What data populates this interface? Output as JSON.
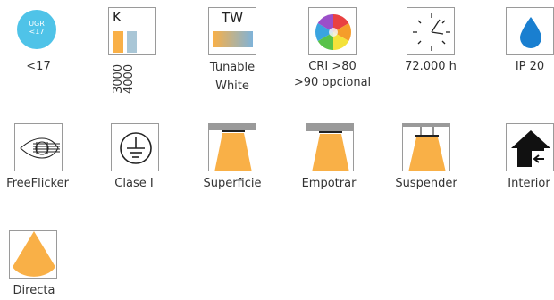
{
  "colors": {
    "accent_orange": "#f9b047",
    "ugr_blue": "#4fc3e8",
    "k_blue": "#a9c6d6",
    "ip_blue": "#1a7fd0",
    "frame_gray": "#9a9a9a",
    "text": "#333333"
  },
  "icons": [
    {
      "name": "ugr-icon",
      "badge_line1": "UGR",
      "badge_line2": "<17",
      "label": "<17"
    },
    {
      "name": "color-temperature-icon",
      "letter": "K",
      "values": [
        "3000",
        "4000"
      ]
    },
    {
      "name": "tunable-white-icon",
      "letter": "TW",
      "label_line1": "Tunable",
      "label_line2": "White"
    },
    {
      "name": "cri-icon",
      "label_line1": "CRI >80",
      "label_line2": ">90 opcional"
    },
    {
      "name": "lifetime-clock-icon",
      "label": "72.000 h"
    },
    {
      "name": "ip-rating-icon",
      "label": "IP 20"
    },
    {
      "name": "free-flicker-icon",
      "label": "FreeFlicker"
    },
    {
      "name": "class-i-icon",
      "label": "Clase I"
    },
    {
      "name": "surface-mount-icon",
      "label": "Superficie"
    },
    {
      "name": "recessed-icon",
      "label": "Empotrar"
    },
    {
      "name": "suspended-icon",
      "label": "Suspender"
    },
    {
      "name": "indoor-icon",
      "label": "Interior"
    },
    {
      "name": "direct-light-icon",
      "label": "Directa"
    }
  ]
}
